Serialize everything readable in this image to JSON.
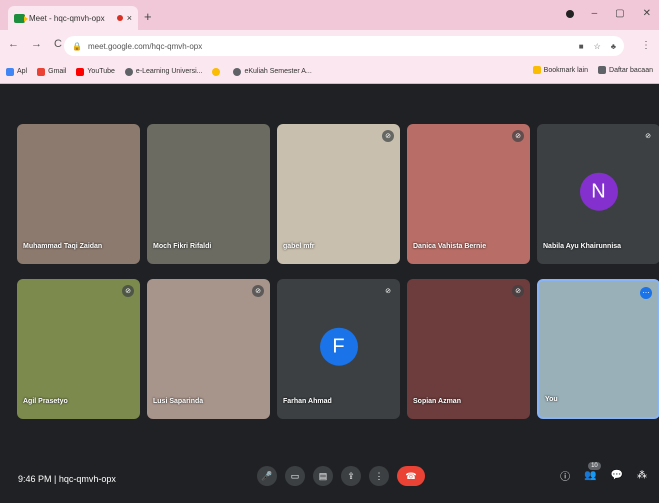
{
  "browser": {
    "tab_title": "Meet - hqc-qmvh-opx",
    "tab_close": "×",
    "new_tab": "+",
    "url": "meet.google.com/hqc-qmvh-opx",
    "bookmarks": [
      {
        "label": "Apl",
        "color": "#4285f4"
      },
      {
        "label": "Gmail",
        "color": "#ea4335"
      },
      {
        "label": "YouTube",
        "color": "#ff0000"
      },
      {
        "label": "e-Learning Universi...",
        "color": "#5f6368"
      },
      {
        "label": "",
        "color": "#fbbc04"
      },
      {
        "label": "eKuliah Semester A...",
        "color": "#5f6368"
      }
    ],
    "bookmarks_right": [
      "Bookmark lain",
      "Daftar bacaan"
    ]
  },
  "participants": [
    {
      "name": "Muhammad Taqi Zaidan",
      "muted": false,
      "avatar": "",
      "bg": "#8d7a6f"
    },
    {
      "name": "Moch Fikri Rifaldi",
      "muted": false,
      "avatar": "",
      "bg": "#6b6b62"
    },
    {
      "name": "gabel mfr",
      "muted": true,
      "avatar": "",
      "bg": "#c9bfae"
    },
    {
      "name": "Danica Vahista Bernie",
      "muted": true,
      "avatar": "",
      "bg": "#b86d66"
    },
    {
      "name": "Nabila Ayu Khairunnisa",
      "muted": true,
      "avatar": "N",
      "bg": "#3c4043",
      "avatar_color": "#8430ce"
    },
    {
      "name": "Agil Prasetyo",
      "muted": true,
      "avatar": "",
      "bg": "#7c8a4e"
    },
    {
      "name": "Lusi Saparinda",
      "muted": true,
      "avatar": "",
      "bg": "#a7948b"
    },
    {
      "name": "Farhan Ahmad",
      "muted": true,
      "avatar": "F",
      "bg": "#3c4043",
      "avatar_color": "#1a73e8"
    },
    {
      "name": "Sopian Azman",
      "muted": true,
      "avatar": "",
      "bg": "#6d3c3c"
    },
    {
      "name": "You",
      "muted": false,
      "avatar": "",
      "bg": "#9ab0b8"
    }
  ],
  "meeting": {
    "time": "9:46 PM",
    "separator": "|",
    "code": "hqc-qmvh-opx",
    "people_count": "10"
  },
  "icons": {
    "mic": "mic-icon",
    "camera": "camera-icon",
    "captions": "captions-icon",
    "present": "present-icon",
    "more": "more-options-icon",
    "end": "end-call-icon",
    "info": "info-icon",
    "people": "people-icon",
    "chat": "chat-icon",
    "activities": "activities-icon"
  }
}
